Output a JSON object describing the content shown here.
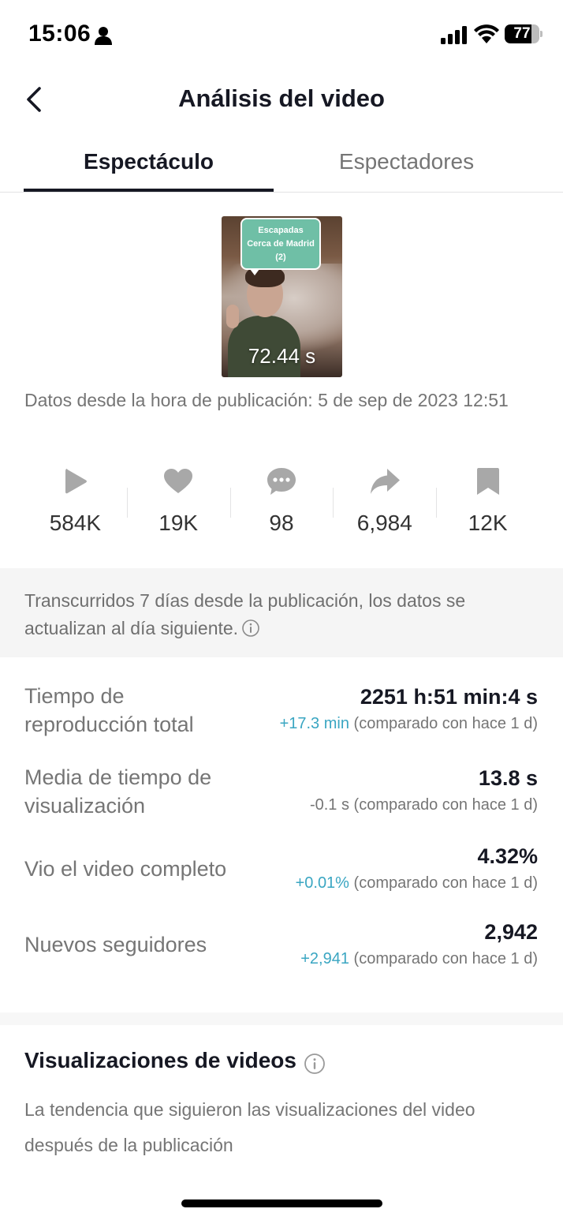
{
  "status_bar": {
    "time": "15:06",
    "battery_level": "77",
    "battery_fraction": 0.77
  },
  "header": {
    "title": "Análisis del video"
  },
  "tabs": [
    {
      "label": "Espectáculo",
      "active": true
    },
    {
      "label": "Espectadores",
      "active": false
    }
  ],
  "video": {
    "overlay_text_line1": "Escapadas",
    "overlay_text_line2": "Cerca de Madrid",
    "overlay_text_line3": "(2)",
    "duration": "72.44 s",
    "bubble_color": "#6fbfa6"
  },
  "data_since": "Datos desde la hora de publicación: 5 de sep de 2023 12:51",
  "stats": [
    {
      "icon": "play-icon",
      "value": "584K"
    },
    {
      "icon": "heart-icon",
      "value": "19K"
    },
    {
      "icon": "comment-icon",
      "value": "98"
    },
    {
      "icon": "share-icon",
      "value": "6,984"
    },
    {
      "icon": "bookmark-icon",
      "value": "12K"
    }
  ],
  "notice": {
    "text": "Transcurridos 7 días desde la publicación, los datos se actualizan al día siguiente."
  },
  "metrics": [
    {
      "label_line1": "Tiempo de",
      "label_line2": "reproducción total",
      "value": "2251 h:51 min:4 s",
      "delta": "+17.3 min",
      "comparison": "(comparado con hace 1 d)"
    },
    {
      "label_line1": "Media de tiempo de",
      "label_line2": "visualización",
      "value": "13.8 s",
      "delta": "-0.1 s",
      "comparison": "(comparado con hace 1 d)"
    },
    {
      "label_line1": "Vio el video completo",
      "label_line2": "",
      "value": "4.32%",
      "delta": "+0.01%",
      "comparison": "(comparado con hace 1 d)"
    },
    {
      "label_line1": "Nuevos seguidores",
      "label_line2": "",
      "value": "2,942",
      "delta": "+2,941",
      "comparison": "(comparado con hace 1 d)"
    }
  ],
  "views_section": {
    "title": "Visualizaciones de videos",
    "description": "La tendencia que siguieron las visualizaciones del video después de la publicación"
  },
  "colors": {
    "positive_delta": "#3aa6c2",
    "text_primary": "#161823",
    "text_secondary": "#757575",
    "icon_gray": "#a8a8a8"
  }
}
